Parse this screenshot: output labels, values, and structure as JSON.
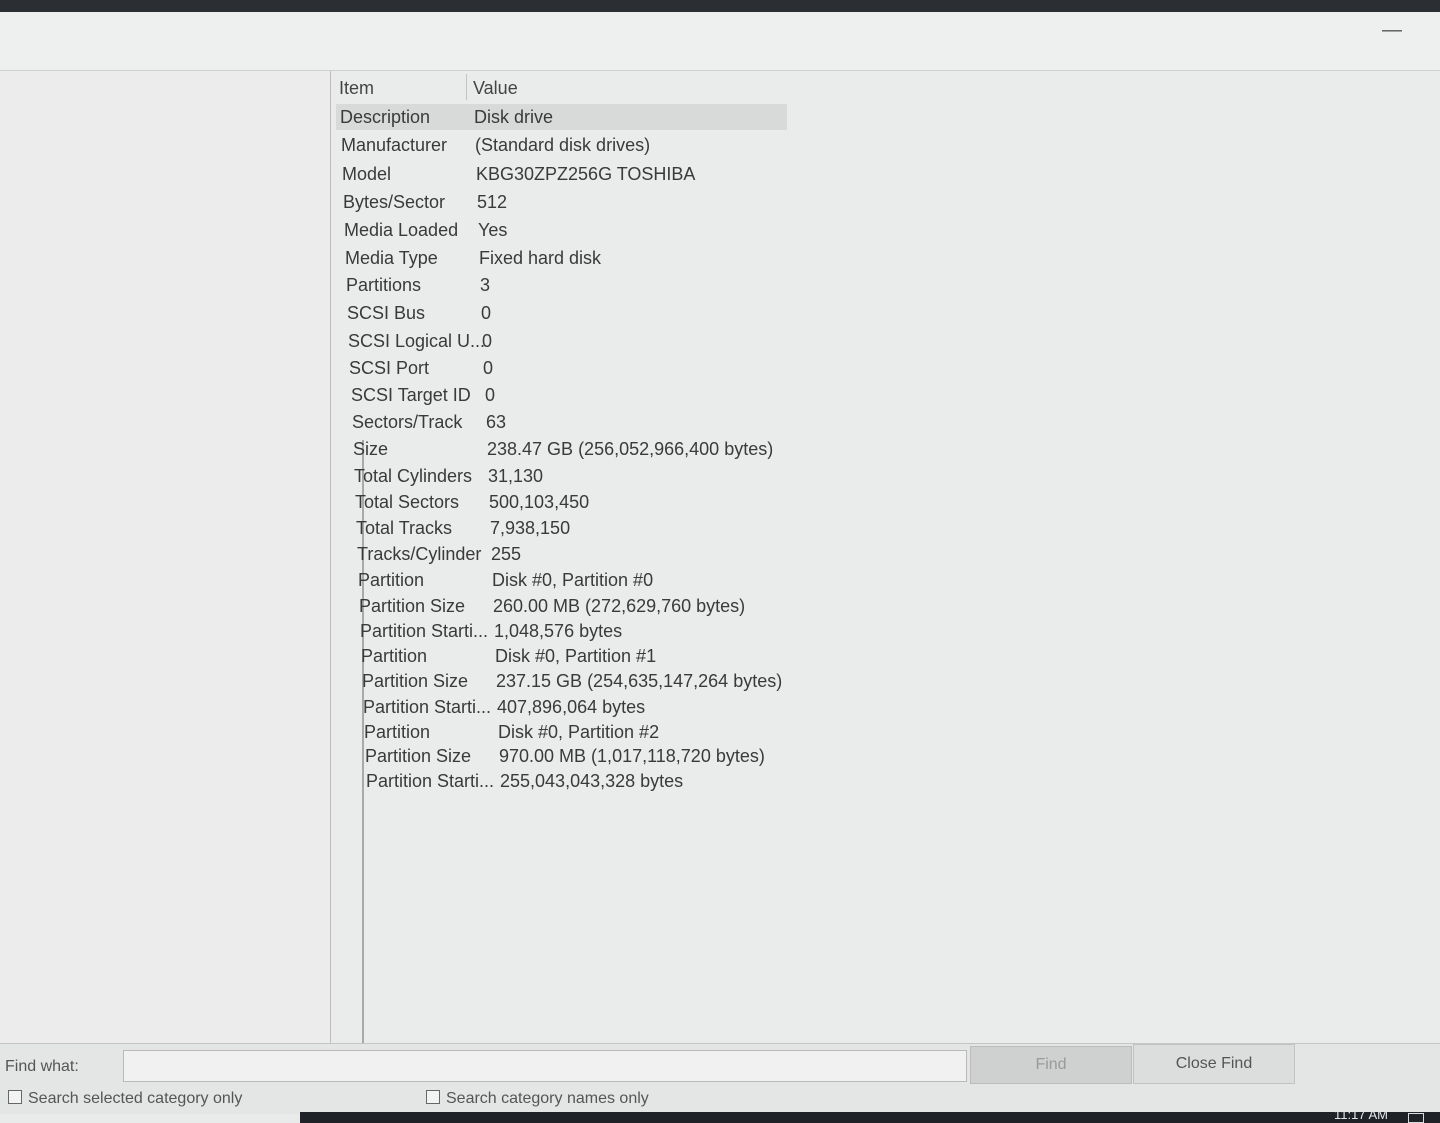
{
  "window": {
    "minimize_glyph": "—"
  },
  "table": {
    "headers": {
      "item": "Item",
      "value": "Value"
    },
    "rows": [
      {
        "item": "Description",
        "value": "Disk drive"
      },
      {
        "item": "Manufacturer",
        "value": "(Standard disk drives)"
      },
      {
        "item": "Model",
        "value": "KBG30ZPZ256G TOSHIBA"
      },
      {
        "item": "Bytes/Sector",
        "value": "512"
      },
      {
        "item": "Media Loaded",
        "value": "Yes"
      },
      {
        "item": "Media Type",
        "value": "Fixed hard disk"
      },
      {
        "item": "Partitions",
        "value": "3"
      },
      {
        "item": "SCSI Bus",
        "value": "0"
      },
      {
        "item": "SCSI Logical U...",
        "value": "0"
      },
      {
        "item": "SCSI Port",
        "value": "0"
      },
      {
        "item": "SCSI Target ID",
        "value": "0"
      },
      {
        "item": "Sectors/Track",
        "value": "63"
      },
      {
        "item": "Size",
        "value": "238.47 GB (256,052,966,400 bytes)"
      },
      {
        "item": "Total Cylinders",
        "value": "31,130"
      },
      {
        "item": "Total Sectors",
        "value": "500,103,450"
      },
      {
        "item": "Total Tracks",
        "value": "7,938,150"
      },
      {
        "item": "Tracks/Cylinder",
        "value": "255"
      },
      {
        "item": "Partition",
        "value": "Disk #0, Partition #0"
      },
      {
        "item": "Partition Size",
        "value": "260.00 MB (272,629,760 bytes)"
      },
      {
        "item": "Partition Starti...",
        "value": "1,048,576 bytes"
      },
      {
        "item": "Partition",
        "value": "Disk #0, Partition #1"
      },
      {
        "item": "Partition Size",
        "value": "237.15 GB (254,635,147,264 bytes)"
      },
      {
        "item": "Partition Starti...",
        "value": "407,896,064 bytes"
      },
      {
        "item": "Partition",
        "value": "Disk #0, Partition #2"
      },
      {
        "item": "Partition Size",
        "value": "970.00 MB (1,017,118,720 bytes)"
      },
      {
        "item": "Partition Starti...",
        "value": "255,043,043,328 bytes"
      }
    ]
  },
  "find_bar": {
    "label": "Find what:",
    "input_value": "",
    "find_button": "Find",
    "close_button": "Close Find",
    "search_selected": "Search selected category only",
    "search_names": "Search category names only"
  },
  "taskbar": {
    "clock": "11:17 AM"
  }
}
